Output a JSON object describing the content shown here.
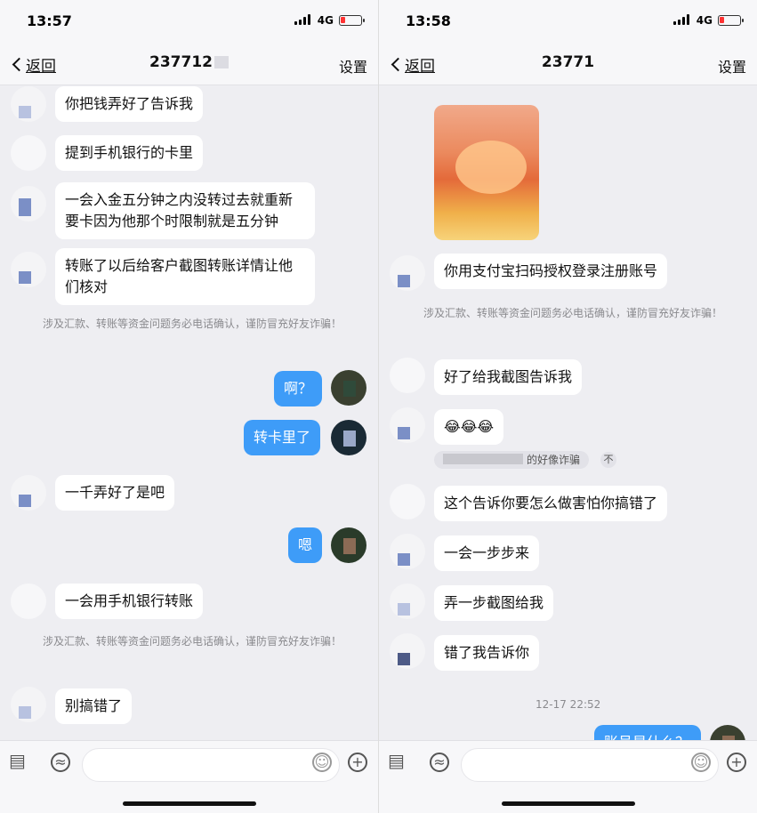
{
  "colors": {
    "bubble_out": "#3e9cf8",
    "bubble_in": "#ffffff",
    "background": "#eeeef2",
    "battery_low": "#ff3333"
  },
  "left": {
    "status": {
      "time": "13:57",
      "network": "4G"
    },
    "nav": {
      "back": "返回",
      "title": "237712",
      "settings": "设置"
    },
    "messages": [
      {
        "text": "你把钱弄好了告诉我"
      },
      {
        "text": "提到手机银行的卡里"
      },
      {
        "text": "一会入金五分钟之内没转过去就重新要卡因为他那个时限制就是五分钟"
      },
      {
        "text": "转账了以后给客户截图转账详情让他们核对"
      },
      {
        "text": "啊？"
      },
      {
        "text": "转卡里了"
      },
      {
        "text": "一千弄好了是吧"
      },
      {
        "text": "嗯"
      },
      {
        "text": "一会用手机银行转账"
      },
      {
        "text": "别搞错了"
      }
    ],
    "notices": [
      "涉及汇款、转账等资金问题务必电话确认，谨防冒充好友诈骗！",
      "涉及汇款、转账等资金问题务必电话确认，谨防冒充好友诈骗！"
    ]
  },
  "right": {
    "status": {
      "time": "13:58",
      "network": "4G"
    },
    "nav": {
      "back": "返回",
      "title": "23771",
      "settings": "设置"
    },
    "messages": [
      {
        "text": "你用支付宝扫码授权登录注册账号"
      },
      {
        "text": "好了给我截图告诉我"
      },
      {
        "text": "😂😂😂"
      },
      {
        "text": "这个告诉你要怎么做害怕你搞错了"
      },
      {
        "text": "一会一步步来"
      },
      {
        "text": "弄一步截图给我"
      },
      {
        "text": "错了我告诉你"
      },
      {
        "text": "账号是什么？"
      }
    ],
    "notice": "涉及汇款、转账等资金问题务必电话确认，谨防冒充好友诈骗！",
    "recall": {
      "text": "的好像诈骗",
      "close": "不"
    },
    "timestamp": "12-17 22:52"
  },
  "icons": [
    "signal-icon",
    "battery-icon",
    "back-chevron-icon",
    "keyboard-icon",
    "voice-icon",
    "emoji-icon",
    "plus-icon"
  ]
}
